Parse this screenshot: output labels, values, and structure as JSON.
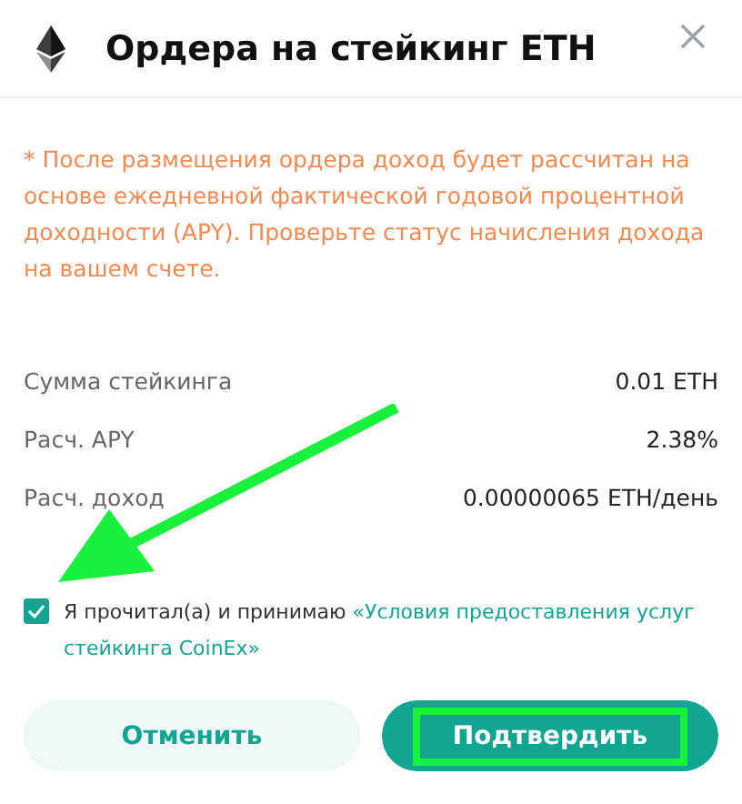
{
  "dialog": {
    "title": "Ордера на стейкинг ETH",
    "notice": "* После размещения ордера доход будет рассчитан на основе ежедневной фактической годовой процентной доходности (APY). Проверьте статус начисления дохода на вашем счете.",
    "details": [
      {
        "label": "Сумма стейкинга",
        "value": "0.01 ETH"
      },
      {
        "label": "Расч. APY",
        "value": "2.38%"
      },
      {
        "label": "Расч. доход",
        "value": "0.00000065 ETH/день"
      }
    ],
    "agreement": {
      "checked": true,
      "text": "Я прочитал(а) и принимаю",
      "link": "«Условия предоставления услуг стейкинга CoinEx»"
    },
    "buttons": [
      {
        "kind": "secondary",
        "label": "Отменить"
      },
      {
        "kind": "primary",
        "label": "Подтвердить",
        "highlighted": true
      }
    ]
  }
}
